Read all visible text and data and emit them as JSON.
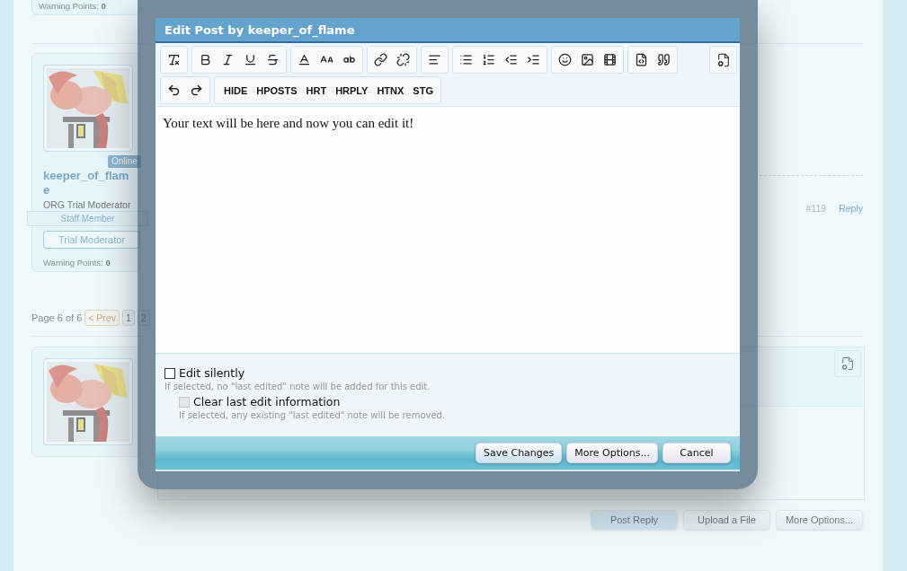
{
  "page": {
    "top_card": {
      "warning_label": "Warning Points:",
      "warning_value": "0"
    },
    "author": {
      "status": "Online",
      "name": "keeper_of_flame",
      "title": "ORG Trial Moderator",
      "ribbon": "Staff Member",
      "banner": "Trial Moderator",
      "warning_label": "Warning Points:",
      "warning_value": "0"
    },
    "post_meta": {
      "number": "#119",
      "reply": "Reply"
    },
    "pagination": {
      "label": "Page 6 of 6",
      "prev": "< Prev",
      "pages": [
        "1",
        "2"
      ]
    },
    "reply_actions": [
      "Post Reply",
      "Upload a File",
      "More Options..."
    ]
  },
  "modal": {
    "title": "Edit Post by keeper_of_flame",
    "custom_buttons": [
      "HIDE",
      "HPOSTS",
      "HRT",
      "HRPLY",
      "HTNX",
      "STG"
    ],
    "editor_text": "Your text will be here and now you can edit it!",
    "options": [
      {
        "label": "Edit silently",
        "hint": "If selected, no \"last edited\" note will be added for this edit.",
        "checked": false,
        "disabled": false
      },
      {
        "label": "Clear last edit information",
        "hint": "If selected, any existing \"last edited\" note will be removed.",
        "checked": false,
        "disabled": true
      }
    ],
    "buttons": [
      "Save Changes",
      "More Options...",
      "Cancel"
    ]
  }
}
